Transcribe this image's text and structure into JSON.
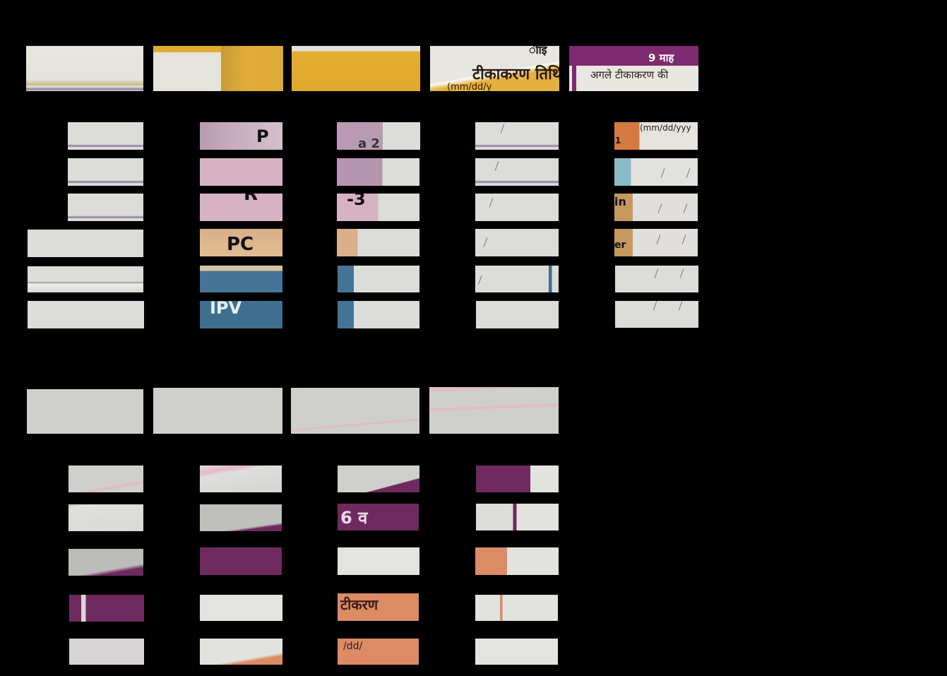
{
  "header": {
    "col4_text_top": "ीाइ",
    "col4_text_main": "टीकाकरण तिथि",
    "col4_text_fmt": "(mm/dd/y",
    "col5_badge": "9 माह",
    "col5_text": "अगले टीकाकरण की"
  },
  "rows": {
    "r1_col2": "P",
    "r1_col3": "a 2",
    "r1_col5_fmt": "(mm/dd/yyy",
    "r1_col5_sub": "1",
    "r3_col2": "R",
    "r3_col3": "-3",
    "r3_col5": "in",
    "r4_col2": "PC",
    "r4_col5": "er",
    "r6_col2": "IPV"
  },
  "lower": {
    "l3_col3": "6 व",
    "l5_col3": "टीकरण",
    "l5_col3_sub": "/dd/"
  }
}
